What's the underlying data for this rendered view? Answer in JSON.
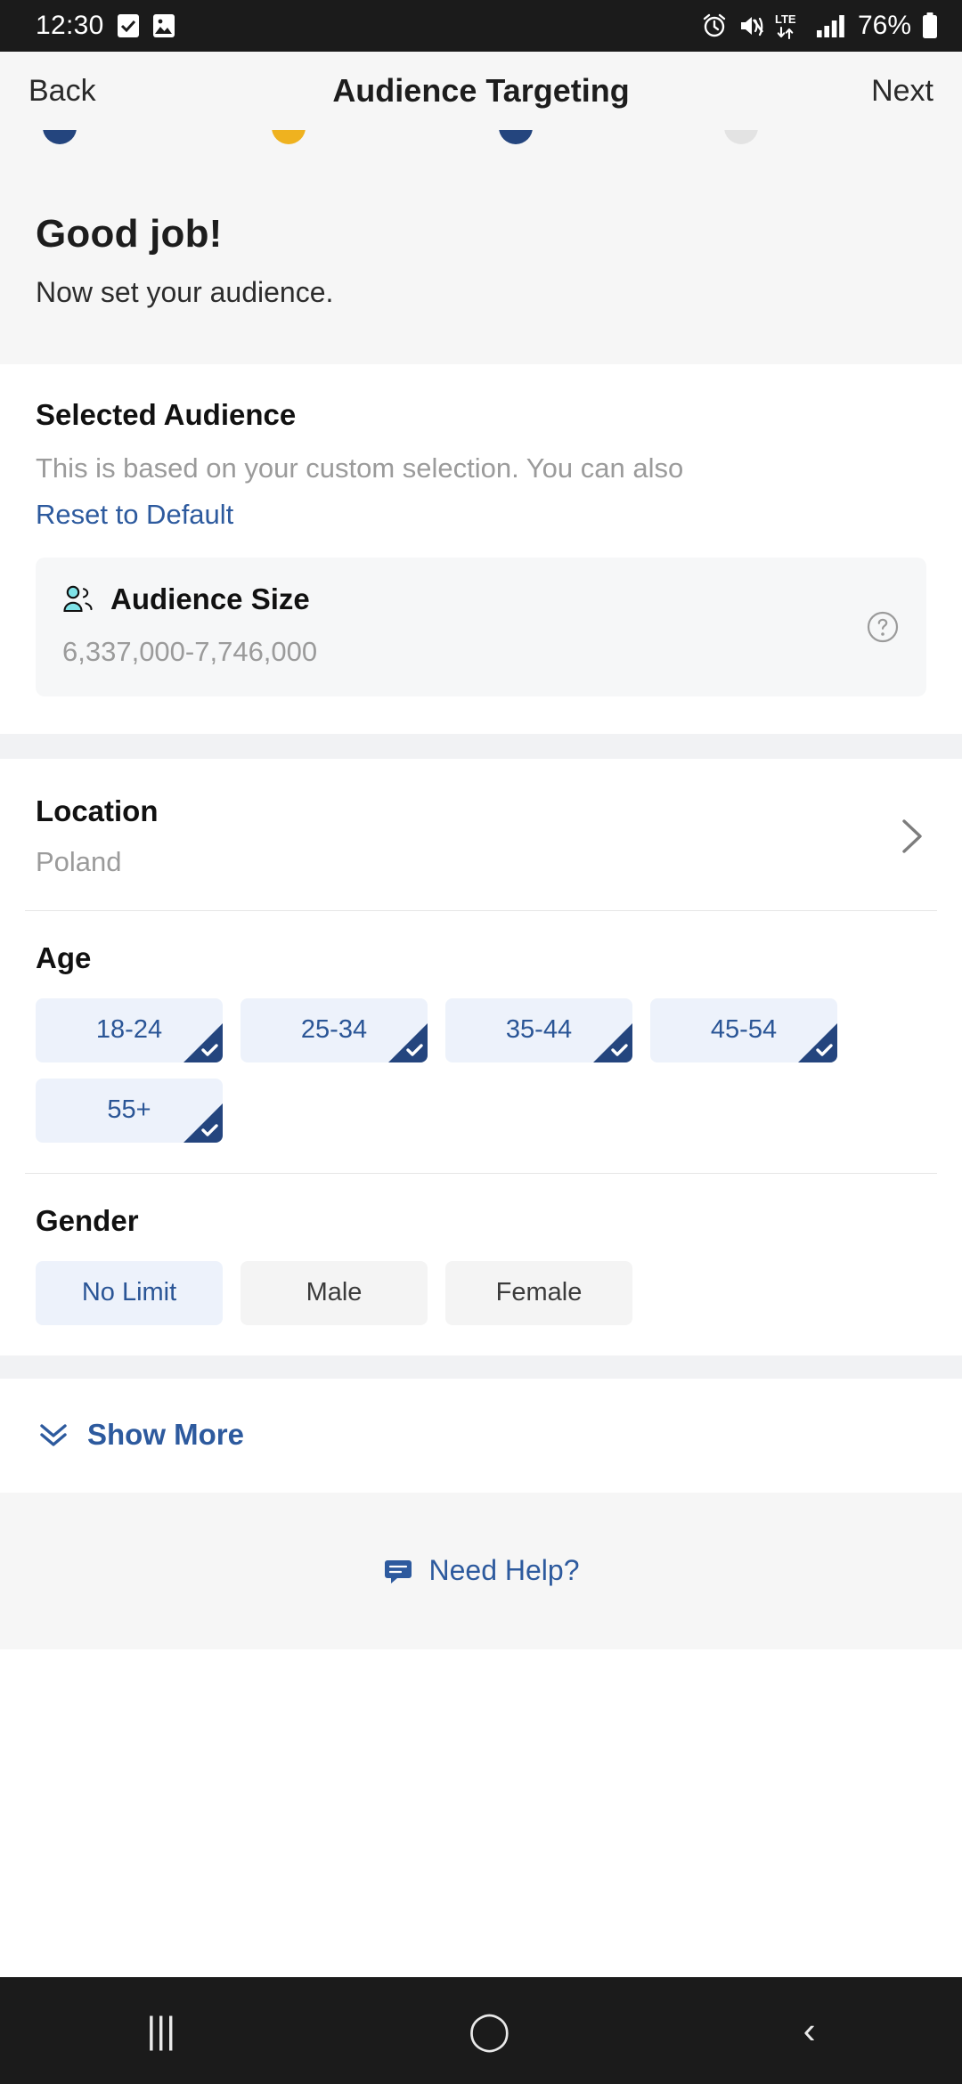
{
  "status_bar": {
    "time": "12:30",
    "left_icons": [
      "checkbox-icon",
      "image-icon"
    ],
    "right_icons": [
      "alarm-icon",
      "mute-vibrate-icon",
      "lte-icon",
      "signal-bars-icon"
    ],
    "network": "LTE",
    "battery_percent": "76%"
  },
  "header": {
    "back_label": "Back",
    "title": "Audience Targeting",
    "next_label": "Next"
  },
  "stepper": {
    "steps": [
      {
        "color": "#24457e",
        "state": "complete"
      },
      {
        "color": "#efb21f",
        "state": "current"
      },
      {
        "color": "#24457e",
        "state": "complete"
      },
      {
        "color": "#e3e3e3",
        "state": "upcoming"
      }
    ]
  },
  "hero": {
    "title": "Good job!",
    "subtitle": "Now set your audience."
  },
  "selected_audience": {
    "title": "Selected Audience",
    "description": "This is based on your custom selection. You can also",
    "reset_link": "Reset to Default",
    "audience_size": {
      "label": "Audience Size",
      "value": "6,337,000-7,746,000",
      "icon": "people-icon",
      "help_icon": "question-circle-icon"
    }
  },
  "location": {
    "label": "Location",
    "value": "Poland",
    "chevron": "chevron-right-icon"
  },
  "age": {
    "label": "Age",
    "options": [
      {
        "label": "18-24",
        "selected": true
      },
      {
        "label": "25-34",
        "selected": true
      },
      {
        "label": "35-44",
        "selected": true
      },
      {
        "label": "45-54",
        "selected": true
      },
      {
        "label": "55+",
        "selected": true
      }
    ]
  },
  "gender": {
    "label": "Gender",
    "options": [
      {
        "label": "No Limit",
        "selected": true
      },
      {
        "label": "Male",
        "selected": false
      },
      {
        "label": "Female",
        "selected": false
      }
    ]
  },
  "show_more": {
    "label": "Show More",
    "icon": "double-chevron-down-icon"
  },
  "need_help": {
    "label": "Need Help?",
    "icon": "chat-bubble-icon"
  },
  "android_nav": {
    "recents": "|||",
    "home": "◯",
    "back": "‹"
  },
  "colors": {
    "accent_blue": "#2d5a9e",
    "navy": "#24457e",
    "gold": "#efb21f",
    "chip_selected_bg": "#edf2fb",
    "chip_unselected_bg": "#f4f4f4",
    "teal": "#7fe3e8"
  }
}
